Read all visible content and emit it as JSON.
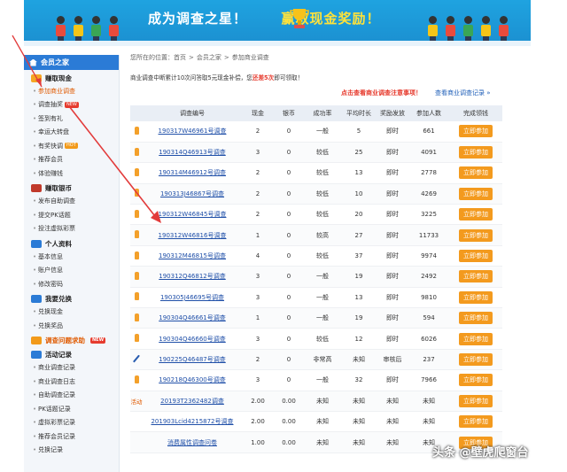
{
  "banner": {
    "title_part1": "成为调查之星！",
    "title_part2": "赢取现金奖励！",
    "colors": {
      "bg": "#1fa3e0",
      "yellow": "#ffe23a"
    }
  },
  "sidebar": {
    "header": "会员之家",
    "groups": [
      {
        "label": "赚取现金",
        "icon": "money-icon",
        "color": "#f5a623",
        "items": [
          {
            "label": "参加商业调查",
            "active": true
          },
          {
            "label": "调查抽奖",
            "tag": "NEW"
          },
          {
            "label": "签到有礼"
          },
          {
            "label": "幸运大转盘"
          },
          {
            "label": "有奖快调",
            "tag": "HOT"
          },
          {
            "label": "推荐会员"
          },
          {
            "label": "体验赚钱"
          }
        ]
      },
      {
        "label": "赚取银币",
        "icon": "coin-icon",
        "color": "#c0392b",
        "items": [
          {
            "label": "发布自助调查"
          },
          {
            "label": "提交PK话题"
          },
          {
            "label": "投注虚拟彩票"
          }
        ]
      },
      {
        "label": "个人资料",
        "icon": "user-icon",
        "color": "#2b7bd6",
        "items": [
          {
            "label": "基本信息"
          },
          {
            "label": "账户信息"
          },
          {
            "label": "修改密码"
          }
        ]
      },
      {
        "label": "我要兑换",
        "icon": "exchange-icon",
        "color": "#2b7bd6",
        "items": [
          {
            "label": "兑换现金"
          },
          {
            "label": "兑换奖品"
          }
        ]
      },
      {
        "label": "调查问题求助",
        "icon": "help-icon",
        "color": "#f29a1a",
        "tag": "NEW",
        "highlight": true,
        "items": []
      },
      {
        "label": "活动记录",
        "icon": "record-icon",
        "color": "#2b7bd6",
        "items": [
          {
            "label": "商业调查记录"
          },
          {
            "label": "商业调查日志"
          },
          {
            "label": "自助调查记录"
          },
          {
            "label": "PK话题记录"
          },
          {
            "label": "虚拟彩票记录"
          },
          {
            "label": "推荐会员记录"
          },
          {
            "label": "兑换记录"
          }
        ]
      }
    ]
  },
  "main": {
    "breadcrumb": [
      "您所在的位置：首页",
      "会员之家",
      "参加商业调查"
    ],
    "notice_pre": "商业调查中断累计10次问答取5元现金补偿，您",
    "notice_red": "还差5次",
    "notice_post": "即可领取！",
    "link_view_rules": "点击查看商业调查注意事项！",
    "link_view_records": "查看商业调查记录 »",
    "columns": [
      "",
      "调查编号",
      "现金",
      "银币",
      "成功率",
      "平均时长",
      "奖励发放",
      "参加人数",
      "完成领钱"
    ],
    "rows": [
      {
        "icon": "person",
        "code": "190317W46961号调查",
        "cash": "2",
        "coin": "0",
        "rate": "一般",
        "avg": "5",
        "pay": "即时",
        "count": "661",
        "btn": "立即参加"
      },
      {
        "icon": "person",
        "code": "190314Q46913号调查",
        "cash": "3",
        "coin": "0",
        "rate": "较低",
        "avg": "25",
        "pay": "即时",
        "count": "4091",
        "btn": "立即参加"
      },
      {
        "icon": "person",
        "code": "190314M46912号调查",
        "cash": "2",
        "coin": "0",
        "rate": "较低",
        "avg": "13",
        "pay": "即时",
        "count": "2778",
        "btn": "立即参加"
      },
      {
        "icon": "person",
        "code": "190313J46867号调查",
        "cash": "2",
        "coin": "0",
        "rate": "较低",
        "avg": "10",
        "pay": "即时",
        "count": "4269",
        "btn": "立即参加"
      },
      {
        "icon": "person",
        "code": "190312W46845号调查",
        "cash": "2",
        "coin": "0",
        "rate": "较低",
        "avg": "20",
        "pay": "即时",
        "count": "3225",
        "btn": "立即参加"
      },
      {
        "icon": "person",
        "code": "190312W46816号调查",
        "cash": "1",
        "coin": "0",
        "rate": "较高",
        "avg": "27",
        "pay": "即时",
        "count": "11733",
        "btn": "立即参加"
      },
      {
        "icon": "person",
        "code": "190312M46815号调查",
        "cash": "4",
        "coin": "0",
        "rate": "较低",
        "avg": "37",
        "pay": "即时",
        "count": "9974",
        "btn": "立即参加"
      },
      {
        "icon": "person",
        "code": "190312Q46812号调查",
        "cash": "3",
        "coin": "0",
        "rate": "一般",
        "avg": "19",
        "pay": "即时",
        "count": "2492",
        "btn": "立即参加"
      },
      {
        "icon": "person",
        "code": "190305J46695号调查",
        "cash": "3",
        "coin": "0",
        "rate": "一般",
        "avg": "13",
        "pay": "即时",
        "count": "9810",
        "btn": "立即参加"
      },
      {
        "icon": "person",
        "code": "190304Q46661号调查",
        "cash": "1",
        "coin": "0",
        "rate": "一般",
        "avg": "19",
        "pay": "即时",
        "count": "594",
        "btn": "立即参加"
      },
      {
        "icon": "person",
        "code": "190304Q46660号调查",
        "cash": "3",
        "coin": "0",
        "rate": "较低",
        "avg": "12",
        "pay": "即时",
        "count": "6026",
        "btn": "立即参加"
      },
      {
        "icon": "pen",
        "code": "190225Q46487号调查",
        "cash": "2",
        "coin": "0",
        "rate": "非常高",
        "avg": "未知",
        "pay": "审核后",
        "count": "237",
        "btn": "立即参加"
      },
      {
        "icon": "person",
        "code": "190218Q46300号调查",
        "cash": "3",
        "coin": "0",
        "rate": "一般",
        "avg": "32",
        "pay": "即时",
        "count": "7966",
        "btn": "立即参加"
      },
      {
        "icon": "activity",
        "icon_label": "活动",
        "code": "20193T2362482调查",
        "cash": "2.00",
        "coin": "0.00",
        "rate": "未知",
        "avg": "未知",
        "pay": "未知",
        "count": "未知",
        "btn": "立即参加"
      },
      {
        "icon": "none",
        "code": "201903Lcid4215872号调查",
        "cash": "2.00",
        "coin": "0.00",
        "rate": "未知",
        "avg": "未知",
        "pay": "未知",
        "count": "未知",
        "btn": "立即参加"
      },
      {
        "icon": "none",
        "code": "消费属性调查问卷",
        "cash": "1.00",
        "coin": "0.00",
        "rate": "未知",
        "avg": "未知",
        "pay": "未知",
        "count": "未知",
        "btn": "立即参加"
      }
    ]
  },
  "watermark": "头条 @壁虎爬窗台"
}
